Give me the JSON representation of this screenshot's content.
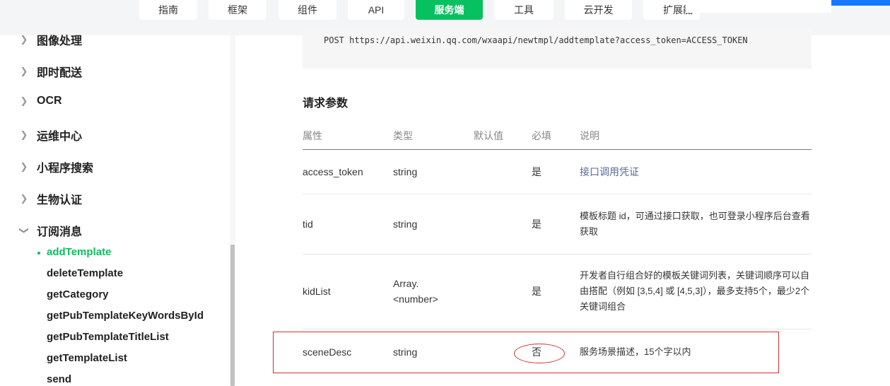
{
  "topnav": {
    "items": [
      {
        "label": "指南",
        "active": false
      },
      {
        "label": "框架",
        "active": false
      },
      {
        "label": "组件",
        "active": false
      },
      {
        "label": "API",
        "active": false
      },
      {
        "label": "服务端",
        "active": true
      },
      {
        "label": "工具",
        "active": false
      },
      {
        "label": "云开发",
        "active": false
      },
      {
        "label": "扩展能",
        "active": false
      }
    ],
    "accent": "#07c160"
  },
  "sidebar": {
    "groups": [
      {
        "label": "图像处理",
        "open": false
      },
      {
        "label": "即时配送",
        "open": false
      },
      {
        "label": "OCR",
        "open": false
      },
      {
        "label": "运维中心",
        "open": false
      },
      {
        "label": "小程序搜索",
        "open": false
      },
      {
        "label": "生物认证",
        "open": false
      },
      {
        "label": "订阅消息",
        "open": true
      }
    ],
    "subitems": [
      {
        "label": "addTemplate",
        "active": true
      },
      {
        "label": "deleteTemplate",
        "active": false
      },
      {
        "label": "getCategory",
        "active": false
      },
      {
        "label": "getPubTemplateKeyWordsById",
        "active": false
      },
      {
        "label": "getPubTemplateTitleList",
        "active": false
      },
      {
        "label": "getTemplateList",
        "active": false
      },
      {
        "label": "send",
        "active": false
      }
    ]
  },
  "content": {
    "request_url": "POST https://api.weixin.qq.com/wxaapi/newtmpl/addtemplate?access_token=ACCESS_TOKEN",
    "params_title": "请求参数",
    "table": {
      "headers": [
        "属性",
        "类型",
        "默认值",
        "必填",
        "说明"
      ],
      "rows": [
        {
          "name": "access_token",
          "type": "string",
          "default": "",
          "required": "是",
          "desc": "接口调用凭证"
        },
        {
          "name": "tid",
          "type": "string",
          "default": "",
          "required": "是",
          "desc": "模板标题 id，可通过接口获取，也可登录小程序后台查看获取"
        },
        {
          "name": "kidList",
          "type": "Array.<number>",
          "default": "",
          "required": "是",
          "desc": "开发者自行组合好的模板关键词列表，关键词顺序可以自由搭配（例如 [3,5,4] 或 [4,5,3]），最多支持5个，最少2个关键词组合"
        },
        {
          "name": "sceneDesc",
          "type": "string",
          "default": "",
          "required": "否",
          "desc": "服务场景描述，15个字以内"
        }
      ]
    }
  },
  "colors": {
    "link": "#576b95",
    "annotation": "#d32f2f"
  }
}
